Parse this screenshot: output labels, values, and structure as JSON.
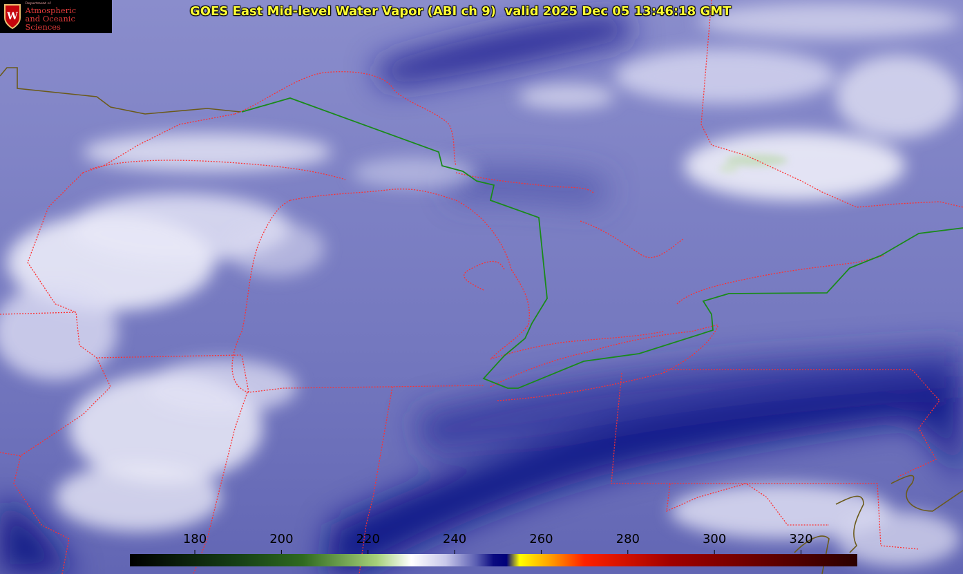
{
  "title": "GOES East Mid-level Water Vapor (ABI ch 9)  valid 2025 Dec 05 13:46:18 GMT",
  "logo": {
    "letter": "W",
    "dept": "Department of",
    "line1": "Atmospheric",
    "line2": "and Oceanic Sciences",
    "icon": "uw-crest-icon"
  },
  "colorbar": {
    "min": 165,
    "max": 333,
    "ticks": [
      180,
      200,
      220,
      240,
      260,
      280,
      300,
      320
    ],
    "tick_labels": [
      "180",
      "200",
      "220",
      "240",
      "260",
      "280",
      "300",
      "320"
    ],
    "stops": [
      {
        "value": 165,
        "color": "#000000"
      },
      {
        "value": 190,
        "color": "#164016"
      },
      {
        "value": 205,
        "color": "#2f6a1f"
      },
      {
        "value": 222,
        "color": "#a6d07a"
      },
      {
        "value": 230,
        "color": "#ffffff"
      },
      {
        "value": 238,
        "color": "#c8c8ea"
      },
      {
        "value": 245,
        "color": "#5a5eb2"
      },
      {
        "value": 249,
        "color": "#0a0a80"
      },
      {
        "value": 252,
        "color": "#00007a"
      },
      {
        "value": 255,
        "color": "#ffff00"
      },
      {
        "value": 262,
        "color": "#ffa000"
      },
      {
        "value": 270,
        "color": "#ff2000"
      },
      {
        "value": 290,
        "color": "#a00000"
      },
      {
        "value": 333,
        "color": "#2a0000"
      }
    ]
  },
  "colors": {
    "boundary": "#ff3030",
    "us_canada_border": "#1a8a1a",
    "coast": "#6b5a1a",
    "title": "#ffff33"
  }
}
